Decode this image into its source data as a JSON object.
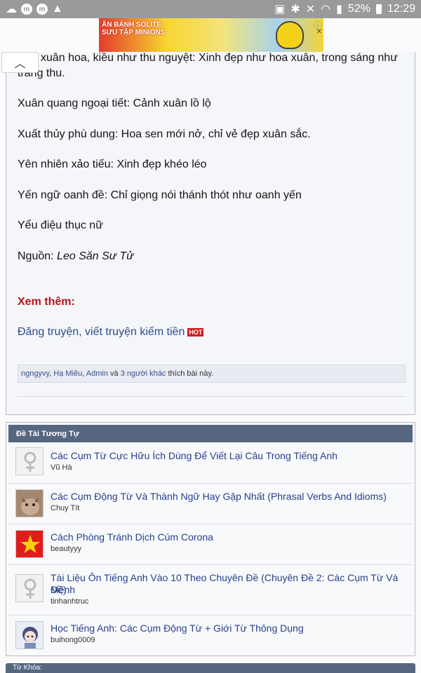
{
  "status_bar": {
    "battery": "52%",
    "time": "12:29"
  },
  "ad": {
    "text_line1": "ĂN BÁNH SOLITE",
    "text_line2": "SƯU TẬP MINIONS",
    "info_icon": "info-icon",
    "close_icon": "close-icon"
  },
  "post": {
    "line0": "như xuân hoa, kiều như thu nguyệt: Xinh đẹp như hoa xuân, trong sáng như",
    "line0b": "trăng thu.",
    "lines": [
      "Xuân quang ngoại tiết: Cảnh xuân lồ lộ",
      "Xuất thủy phù dung: Hoa sen mới nở, chỉ vẻ đẹp xuân sắc.",
      "Yên nhiên xảo tiếu: Xinh đẹp khéo léo",
      "Yến ngữ oanh đề: Chỉ giọng nói thánh thót như oanh yến",
      "Yểu điệu thục nữ"
    ],
    "source_label": "Nguồn: ",
    "source_value": "Leo Săn Sư Tử",
    "see_more": "Xem thêm:",
    "link_text": "Đăng truyện, viết truyện kiếm tiền",
    "hot_badge": "HOT",
    "likes": {
      "user1": "ngngyvy",
      "user2": "Hạ Miêu",
      "user3": "Admin",
      "and": " và ",
      "others": "3 người khác",
      "suffix": " thích bài này."
    }
  },
  "similar": {
    "header": "Đề Tài Tương Tự",
    "items": [
      {
        "title": "Các Cụm Từ Cực Hữu Ích Dùng Để Viết Lại Câu Trong Tiếng Anh",
        "author": "Vũ Hà",
        "avatar": "female-symbol-icon"
      },
      {
        "title": "Các Cụm Động Từ Và Thành Ngữ Hay Gặp Nhất (Phrasal Verbs And Idioms)",
        "author": "Chuy Tít",
        "avatar": "cat-photo"
      },
      {
        "title": "Cách Phòng Tránh Dịch Cúm Corona",
        "author": "beautyyy",
        "avatar": "star-flag-icon"
      },
      {
        "title": "Tài Liệu Ôn Tiếng Anh Vào 10 Theo Chuyên Đề (Chuyên Đề 2: Các Cụm Từ Và Mệnh",
        "title2": "Đề)",
        "author": "tinhanhtruc",
        "avatar": "female-symbol-icon"
      },
      {
        "title": "Học Tiếng Anh: Các Cụm Động Từ + Giới Từ Thông Dụng",
        "author": "buihong0009",
        "avatar": "anime-avatar"
      }
    ]
  },
  "tags_header": "Từ Khóa:"
}
